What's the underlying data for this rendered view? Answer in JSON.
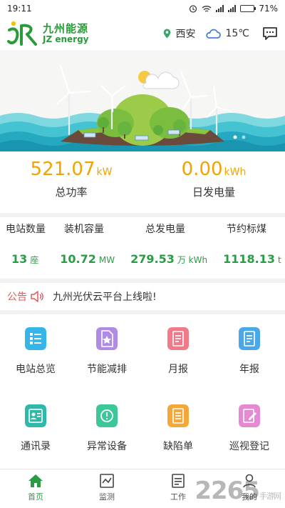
{
  "status_bar": {
    "time": "19:11",
    "battery": "71%",
    "battery_level": 0.71
  },
  "header": {
    "logo_cn": "九州能源",
    "logo_en": "JZ energy",
    "location": "西安",
    "temperature": "15℃"
  },
  "power": [
    {
      "value": "521.07",
      "unit": "kW",
      "label": "总功率"
    },
    {
      "value": "0.00",
      "unit": "kWh",
      "label": "日发电量"
    }
  ],
  "stats": [
    {
      "label": "电站数量",
      "value": "13",
      "unit": "座"
    },
    {
      "label": "装机容量",
      "value": "10.72",
      "unit": "MW"
    },
    {
      "label": "总发电量",
      "value": "279.53",
      "unit": "万 kWh"
    },
    {
      "label": "节约标煤",
      "value": "1118.13",
      "unit": "t"
    }
  ],
  "notice": {
    "label": "公告",
    "text": "九州光伏云平台上线啦!"
  },
  "grid": [
    {
      "label": "电站总览",
      "icon": "station-overview-icon",
      "color": "#36b6e8"
    },
    {
      "label": "节能减排",
      "icon": "energy-saving-icon",
      "color": "#b08be6"
    },
    {
      "label": "月报",
      "icon": "monthly-report-icon",
      "color": "#f07a8a"
    },
    {
      "label": "年报",
      "icon": "annual-report-icon",
      "color": "#4aa8e8"
    },
    {
      "label": "通讯录",
      "icon": "contacts-icon",
      "color": "#2fb9a8"
    },
    {
      "label": "异常设备",
      "icon": "abnormal-device-icon",
      "color": "#3cc79a"
    },
    {
      "label": "缺陷单",
      "icon": "defect-list-icon",
      "color": "#f5a83a"
    },
    {
      "label": "巡视登记",
      "icon": "inspection-icon",
      "color": "#e58ad0"
    }
  ],
  "tabs": [
    {
      "label": "首页",
      "icon": "home-icon",
      "active": true
    },
    {
      "label": "监测",
      "icon": "monitor-icon",
      "active": false
    },
    {
      "label": "工作",
      "icon": "work-icon",
      "active": false
    },
    {
      "label": "我的",
      "icon": "profile-icon",
      "active": false
    }
  ],
  "watermark": {
    "number": "2265",
    "text": "手游网"
  },
  "colors": {
    "brand_green": "#2a9c45",
    "power_orange": "#f0a400",
    "notice_red": "#e05a5a"
  }
}
